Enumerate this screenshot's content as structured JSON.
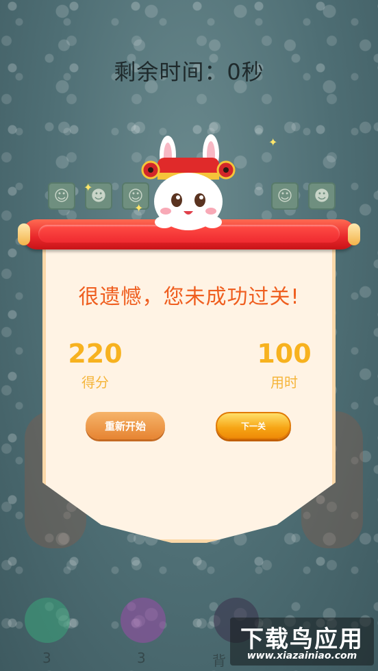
{
  "timer": {
    "text": "剩余时间：0秒"
  },
  "dialog": {
    "message": "很遗憾，您未成功过关!",
    "score": {
      "value": "220",
      "label": "得分"
    },
    "time_used": {
      "value": "100",
      "label": "用时"
    },
    "restart_label": "重新开始",
    "next_label": "下一关"
  },
  "board": {
    "tiles": [
      "cat-tile-icon",
      "lucky-cat-tile-icon",
      "tabby-cat-tile-icon",
      "hamster-tile-icon",
      "lucky-cat-tile-icon"
    ]
  },
  "bottom_bar": {
    "counts": [
      "3",
      "3"
    ],
    "partial_label": "背"
  },
  "watermark": {
    "title": "下载鸟应用",
    "url": "www.xiazainiao.com"
  },
  "colors": {
    "accent_orange": "#ef5e1f",
    "stat_gold": "#f7b21f",
    "scroll_red": "#e8262a"
  }
}
